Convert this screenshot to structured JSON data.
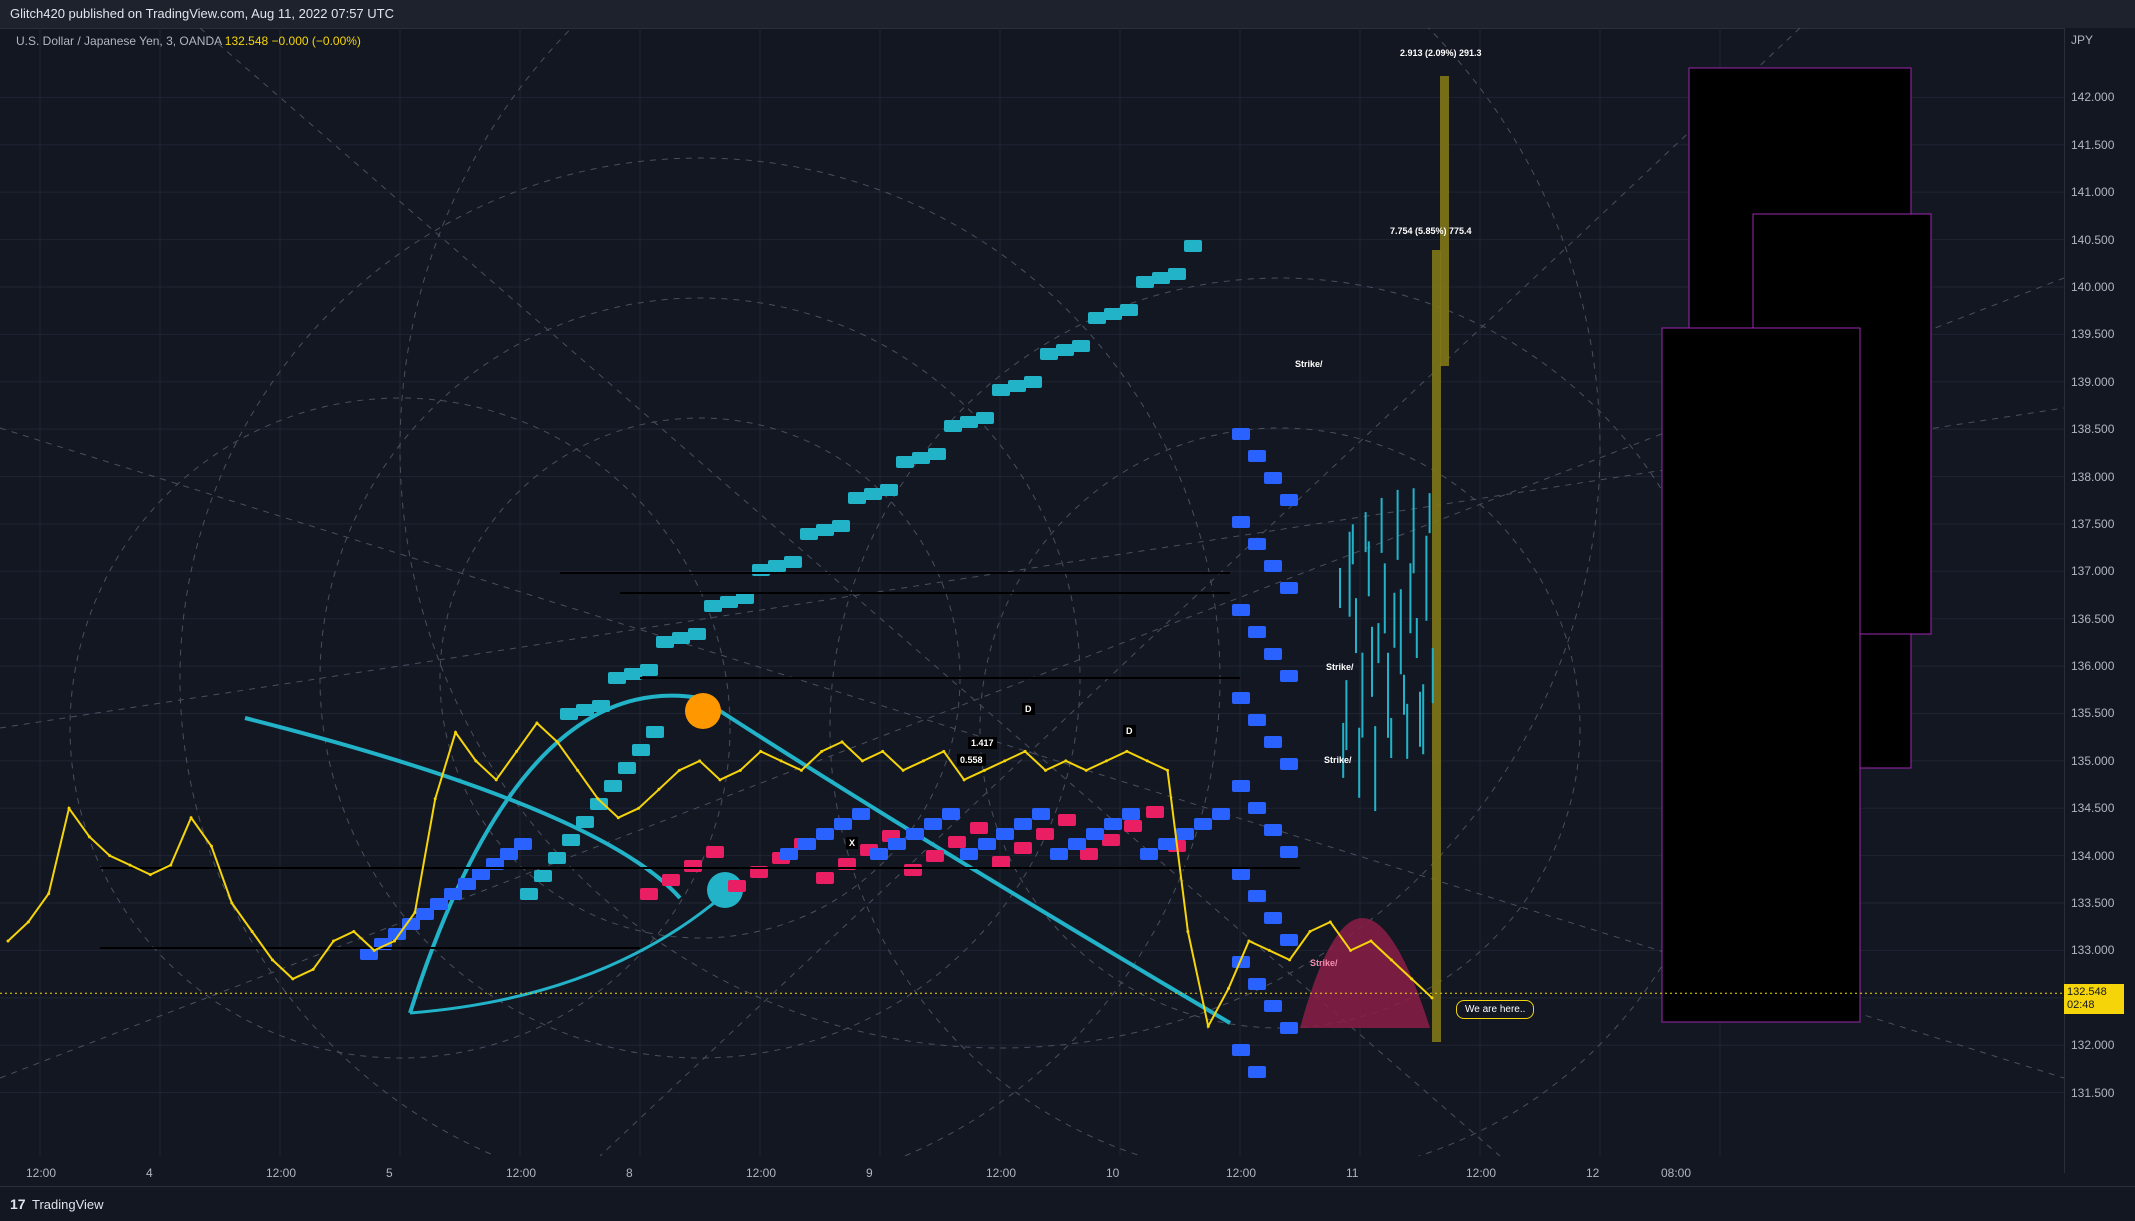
{
  "header": {
    "published": "Glitch420 published on TradingView.com, Aug 11, 2022 07:57 UTC"
  },
  "legend": {
    "symbol": "U.S. Dollar / Japanese Yen, 3, OANDA",
    "price": "132.548",
    "change": "−0.000 (−0.00%)"
  },
  "axis": {
    "currency": "JPY",
    "current_price": "132.548",
    "countdown": "02:48"
  },
  "annotations": {
    "measure_top": "2.913 (2.09%) 291.3",
    "measure_mid": "7.754 (5.85%) 775.4",
    "strike_1": "Strike/",
    "strike_2": "Strike/",
    "strike_3": "Strike/",
    "strike_4": "Strike/",
    "we_are_here": "We are here..",
    "label_d1": "D",
    "label_d2": "D",
    "label_1417": "1.417",
    "label_0558": "0.558",
    "label_x": "X"
  },
  "footer": {
    "brand": "TradingView",
    "logo_icon": "tradingview-logo-icon"
  },
  "colors": {
    "background": "#131722",
    "price_line": "#f5d50a",
    "teal": "#22b3c9",
    "pink": "#e91e63",
    "blue": "#2962ff",
    "orange": "#ff9800",
    "olive": "#827717",
    "magenta_box": "#9c27b0"
  },
  "chart_data": {
    "type": "line",
    "title": "U.S. Dollar / Japanese Yen, 3, OANDA",
    "xlabel": "",
    "ylabel": "JPY",
    "ylim": [
      131.0,
      142.5
    ],
    "y_ticks": [
      "142.000",
      "141.500",
      "141.000",
      "140.500",
      "140.000",
      "139.500",
      "139.000",
      "138.500",
      "138.000",
      "137.500",
      "137.000",
      "136.500",
      "136.000",
      "135.500",
      "135.000",
      "134.500",
      "134.000",
      "133.500",
      "133.000",
      "132.500",
      "132.000",
      "131.500"
    ],
    "y_tick_values": [
      142.0,
      141.5,
      141.0,
      140.5,
      140.0,
      139.5,
      139.0,
      138.5,
      138.0,
      137.5,
      137.0,
      136.5,
      136.0,
      135.5,
      135.0,
      134.5,
      134.0,
      133.5,
      133.0,
      132.5,
      132.0,
      131.5
    ],
    "x_ticks": [
      "12:00",
      "4",
      "12:00",
      "5",
      "12:00",
      "8",
      "12:00",
      "9",
      "12:00",
      "10",
      "12:00",
      "11",
      "12:00",
      "12",
      "08:00"
    ],
    "series": [
      {
        "x": [
          0,
          2,
          4,
          6,
          8,
          10,
          12,
          14,
          16,
          18,
          20,
          22,
          24,
          26,
          28,
          30,
          32,
          34,
          36,
          38,
          40,
          42,
          44,
          46,
          48,
          50,
          52,
          54,
          56,
          58,
          60,
          62,
          64,
          66,
          68,
          70,
          72,
          74,
          76,
          78,
          80,
          82,
          84,
          86,
          88,
          90,
          92,
          94,
          96,
          98,
          100,
          102,
          104,
          106,
          108,
          110,
          112,
          114,
          116,
          118,
          120,
          122,
          124,
          126,
          128,
          130,
          132,
          134,
          136,
          138,
          140
        ],
        "values": [
          133.1,
          133.3,
          133.6,
          134.5,
          134.2,
          134.0,
          133.9,
          133.8,
          133.9,
          134.4,
          134.1,
          133.5,
          133.2,
          132.9,
          132.7,
          132.8,
          133.1,
          133.2,
          133.0,
          133.1,
          133.4,
          134.6,
          135.3,
          135.0,
          134.8,
          135.1,
          135.4,
          135.2,
          134.9,
          134.6,
          134.4,
          134.5,
          134.7,
          134.9,
          135.0,
          134.8,
          134.9,
          135.1,
          135.0,
          134.9,
          135.1,
          135.2,
          135.0,
          135.1,
          134.9,
          135.0,
          135.1,
          134.8,
          134.9,
          135.0,
          135.1,
          134.9,
          135.0,
          134.9,
          135.0,
          135.1,
          135.0,
          134.9,
          133.2,
          132.2,
          132.6,
          133.1,
          133.0,
          132.9,
          133.2,
          133.3,
          133.0,
          133.1,
          132.9,
          132.7,
          132.5
        ],
        "name": ""
      }
    ],
    "measurements": [
      {
        "label": "2.913 (2.09%) 291.3"
      },
      {
        "label": "7.754 (5.85%) 775.4"
      }
    ],
    "current_price": 132.548,
    "grid": true,
    "legend_position": "top-left"
  }
}
